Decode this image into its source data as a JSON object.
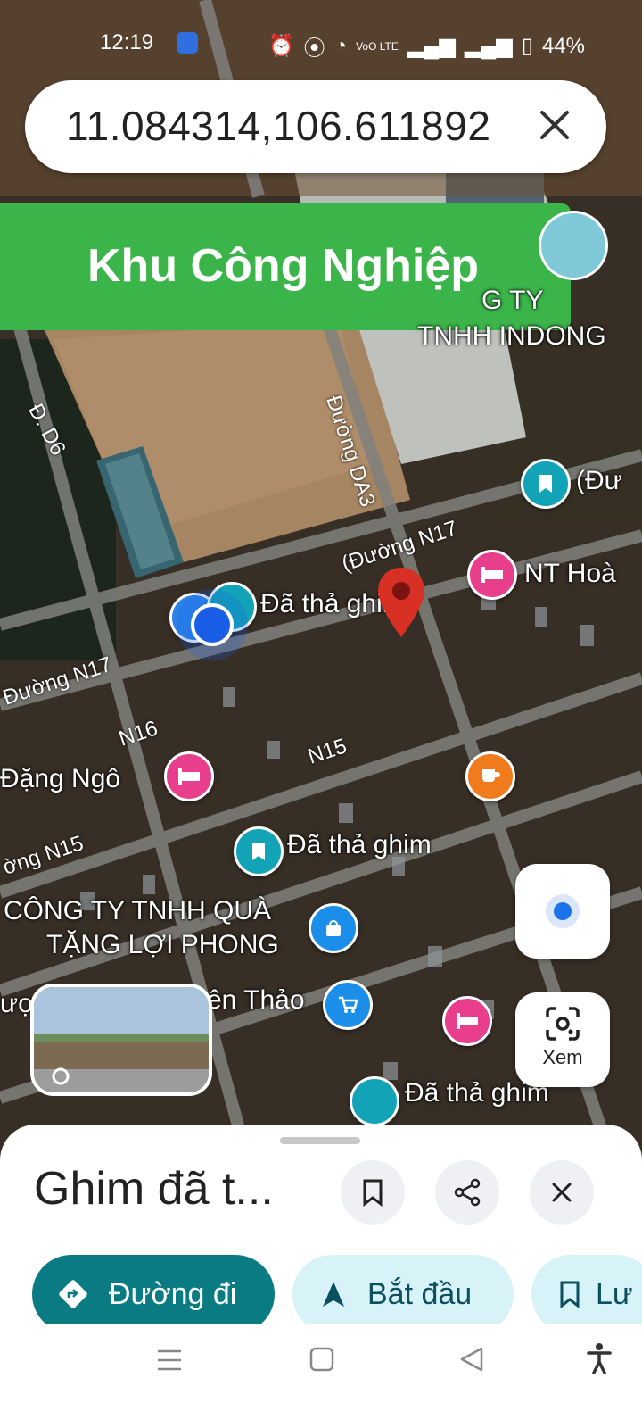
{
  "status_bar": {
    "time": "12:19",
    "network": "VoO LTE",
    "battery": "44%"
  },
  "search": {
    "query": "11.084314,106.611892"
  },
  "banner": {
    "text": "Khu Công Nghiệp"
  },
  "map_labels": {
    "company_1_line1": "G TY",
    "company_1_line2": "TNHH INDONG",
    "road_da3": "Đường DA3",
    "road_d6": "Đ. D6",
    "road_n17_a": "(Đường N17",
    "road_n17_b": "Đường N17",
    "road_n16": "N16",
    "road_n15_a": "N15",
    "road_n15_b": "ờng N15",
    "poi_duo": "(Đư",
    "poi_nt_hoa": "NT Hoà",
    "pin_dropped_1": "Đã thả ghim",
    "poi_dang_ngo": "Đặng Ngô",
    "pin_dropped_2": "Đã thả ghim",
    "company_2_line1": "CÔNG TY TNHH QUÀ",
    "company_2_line2": "TẶNG LỢI PHONG",
    "poi_uong": "ượ",
    "poi_thao": "ên Thảo",
    "pin_dropped_3": "Đã thả ghim"
  },
  "controls": {
    "lens_label": "Xem"
  },
  "sheet": {
    "title": "Ghim đã t...",
    "directions_label": "Đường đi",
    "start_label": "Bắt đầu",
    "save_label": "Lư"
  },
  "colors": {
    "banner_green": "#3bb54a",
    "primary_teal": "#0a7b83",
    "secondary_chip": "#d8f3f8",
    "pin_red": "#d93025",
    "hotel_pink": "#e83e8c",
    "cafe_orange": "#f07b1d",
    "bookmark_teal": "#12a4b6",
    "shop_blue": "#1a8ee8"
  },
  "icons": {
    "search_clear": "close-icon",
    "my_location": "my-location-icon",
    "lens": "lens-icon",
    "save": "bookmark-icon",
    "share": "share-icon",
    "close": "close-icon",
    "directions": "directions-icon",
    "start": "navigation-arrow-icon",
    "nav_recents": "menu-icon",
    "nav_home": "square-icon",
    "nav_back": "back-icon",
    "accessibility": "accessibility-icon"
  }
}
